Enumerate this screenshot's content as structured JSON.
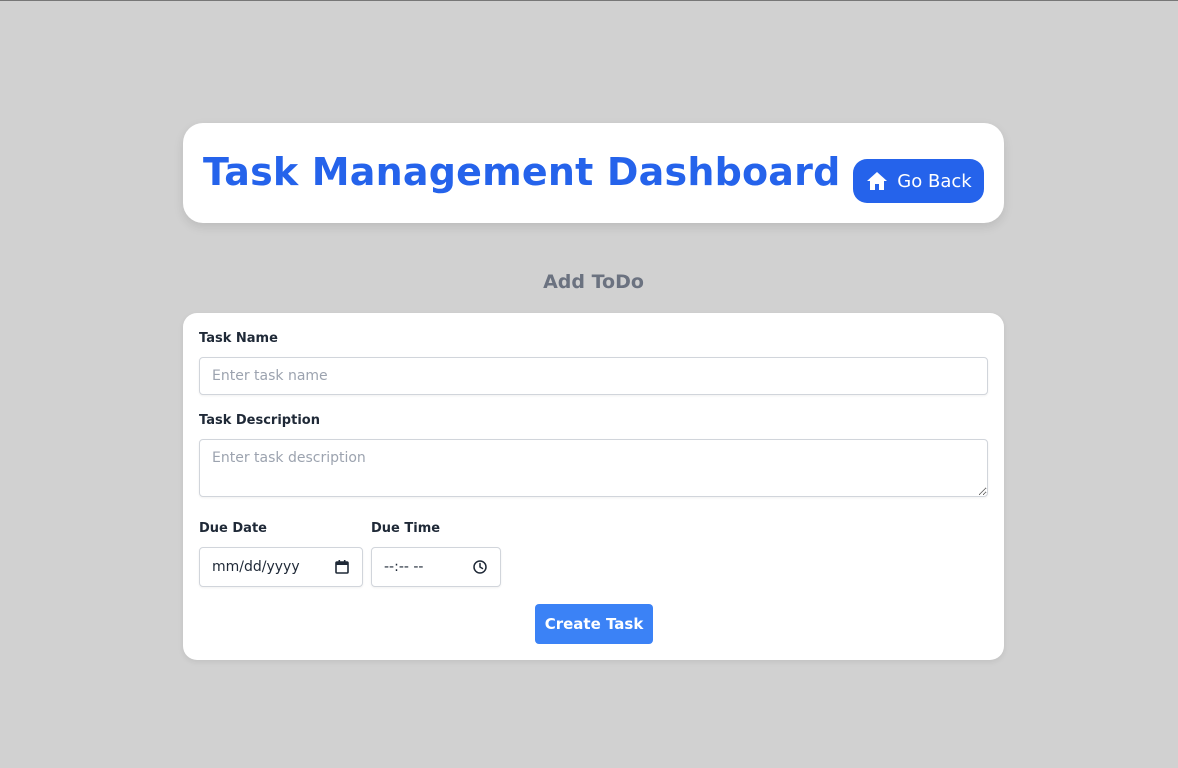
{
  "header": {
    "title": "Task Management Dashboard",
    "back_button_label": "Go Back",
    "back_button_icon": "home-icon"
  },
  "form": {
    "heading": "Add ToDo",
    "task_name": {
      "label": "Task Name",
      "placeholder": "Enter task name",
      "value": ""
    },
    "task_description": {
      "label": "Task Description",
      "placeholder": "Enter task description",
      "value": ""
    },
    "due_date": {
      "label": "Due Date",
      "display": "mm/dd/yyyy",
      "icon": "calendar-icon"
    },
    "due_time": {
      "label": "Due Time",
      "display": "--:-- --",
      "icon": "clock-icon"
    },
    "submit_label": "Create Task"
  },
  "colors": {
    "background": "#d1d1d1",
    "brand_blue": "#2563eb",
    "button_blue": "#3b82f6",
    "heading_gray": "#6b7280"
  }
}
